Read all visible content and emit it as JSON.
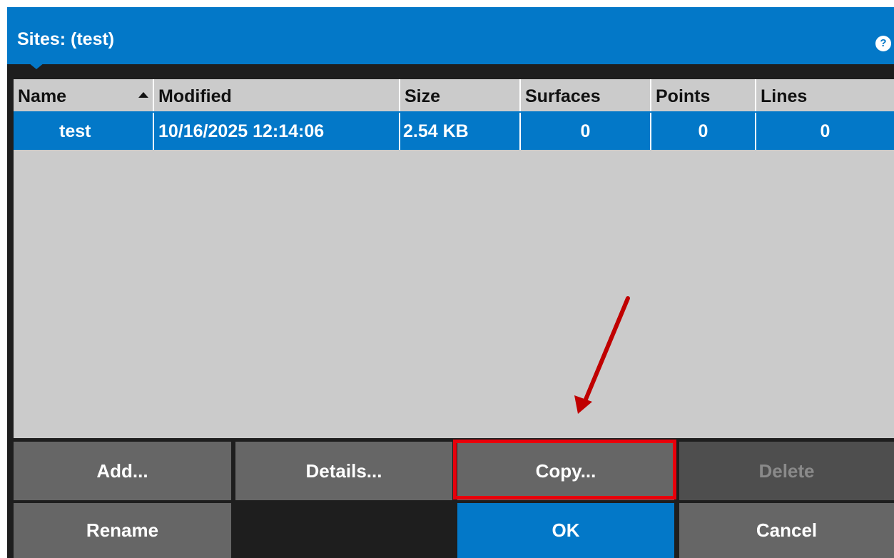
{
  "dialog": {
    "title": "Sites: (test)",
    "help_icon": "help-icon",
    "help_glyph": "?"
  },
  "table": {
    "columns": [
      "Name",
      "Modified",
      "Size",
      "Surfaces",
      "Points",
      "Lines"
    ],
    "sort_column": "Name",
    "sort_direction": "ascending",
    "rows": [
      {
        "name": "test",
        "modified": "10/16/2025 12:14:06",
        "size": "2.54 KB",
        "surfaces": "0",
        "points": "0",
        "lines": "0",
        "selected": true
      }
    ]
  },
  "buttons": {
    "add": "Add...",
    "details": "Details...",
    "copy": "Copy...",
    "delete": "Delete",
    "rename": "Rename",
    "ok": "OK",
    "cancel": "Cancel"
  },
  "annotation": {
    "highlight_target": "Copy...",
    "highlight_color": "#e8000b",
    "arrow_color": "#c00000"
  },
  "colors": {
    "accent": "#0378c8",
    "list_background": "#cbcbcb",
    "button_gray": "#666666",
    "frame": "#1e1e1e"
  }
}
